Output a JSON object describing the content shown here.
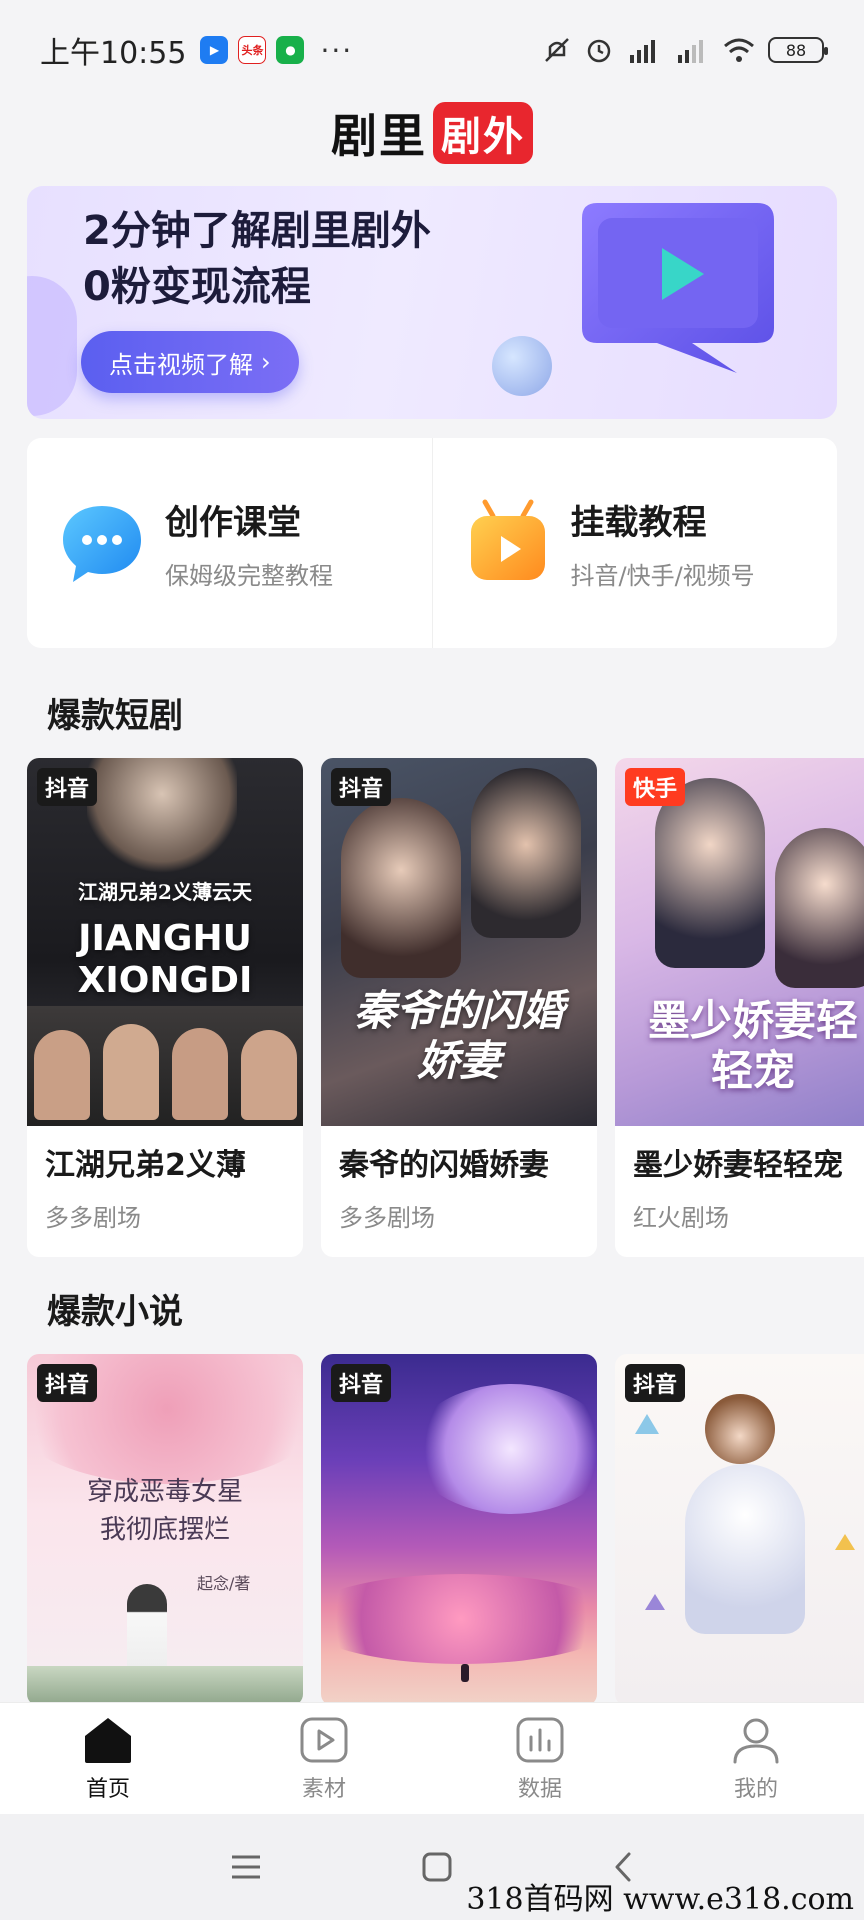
{
  "status_bar": {
    "time": "上午10:55",
    "app_badge_news": "头条",
    "more": "···",
    "battery": "88"
  },
  "logo": {
    "left": "剧里",
    "right": "剧外"
  },
  "banner": {
    "title_line1": "2分钟了解剧里剧外",
    "title_line2": "0粉变现流程",
    "button_label": "点击视频了解",
    "button_chevron": "›"
  },
  "features": [
    {
      "title": "创作课堂",
      "subtitle": "保姆级完整教程",
      "icon": "chat-bubble-icon"
    },
    {
      "title": "挂载教程",
      "subtitle": "抖音/快手/视频号",
      "icon": "tv-play-icon"
    }
  ],
  "dramas": {
    "section_title": "爆款短剧",
    "items": [
      {
        "platform": "抖音",
        "title": "江湖兄弟2义薄",
        "studio": "多多剧场",
        "poster_text": "JIANGHU XIONGDI",
        "poster_sub": "江湖兄弟2义薄云天"
      },
      {
        "platform": "抖音",
        "title": "秦爷的闪婚娇妻",
        "studio": "多多剧场",
        "poster_text": "秦爷的闪婚娇妻"
      },
      {
        "platform": "快手",
        "title": "墨少娇妻轻轻宠",
        "studio": "红火剧场",
        "poster_text": "墨少娇妻轻轻宠"
      }
    ]
  },
  "novels": {
    "section_title": "爆款小说",
    "items": [
      {
        "platform": "抖音",
        "poster_line1": "穿成恶毒女星",
        "poster_line2": "我彻底摆烂",
        "author": "起念/著"
      },
      {
        "platform": "抖音"
      },
      {
        "platform": "抖音"
      }
    ]
  },
  "bottom_nav": [
    {
      "label": "首页",
      "icon": "home-icon",
      "active": true
    },
    {
      "label": "素材",
      "icon": "video-icon",
      "active": false
    },
    {
      "label": "数据",
      "icon": "chart-icon",
      "active": false
    },
    {
      "label": "我的",
      "icon": "user-icon",
      "active": false
    }
  ],
  "watermark": "318首码网 www.e318.com"
}
